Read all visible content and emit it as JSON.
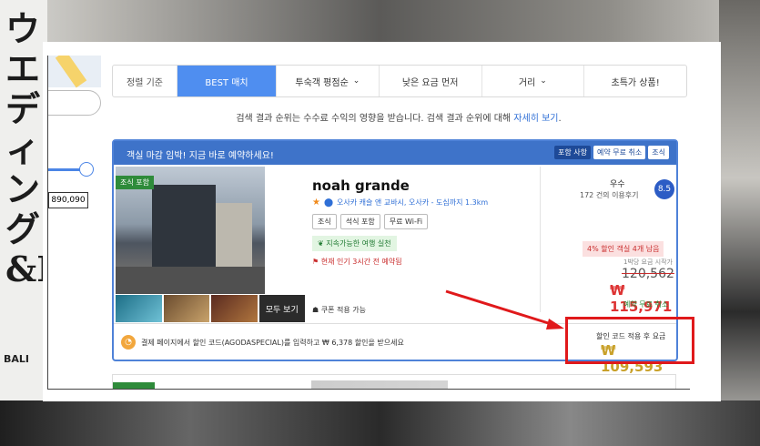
{
  "background": {
    "sign_text": "ウエディング&F",
    "sign_sub": "BALI"
  },
  "sidebar": {
    "price_value": "890,090"
  },
  "sort_bar": {
    "label": "정렬 기준",
    "options": [
      {
        "label": "BEST 매치",
        "active": true,
        "dropdown": false
      },
      {
        "label": "투숙객 평점순",
        "active": false,
        "dropdown": true
      },
      {
        "label": "낮은 요금 먼저",
        "active": false,
        "dropdown": false
      },
      {
        "label": "거리",
        "active": false,
        "dropdown": true
      },
      {
        "label": "초특가 상품!",
        "active": false,
        "dropdown": false
      }
    ]
  },
  "notice": {
    "text": "검색 결과 순위는 수수료 수익의 영향을 받습니다. 검색 결과 순위에 대해",
    "link": "자세히 보기",
    "end": "."
  },
  "hotel": {
    "banner": "객실 마감 임박! 지금 바로 예약하세요!",
    "badges": [
      "포함 사항",
      "예약 무료 취소",
      "조식"
    ],
    "meal_tag": "조식 포함",
    "name": "noah grande",
    "location": "오사카 캐슬 앤 교바시, 오사카 - 도심까지 1.3km",
    "amenities": [
      "조식",
      "석식 포함",
      "무료 Wi-Fi"
    ],
    "eco": "지속가능한 여행 실천",
    "popular": "현재 인기 3시간 전 예약됨",
    "view_all": "모두 보기",
    "coupon": "쿠폰 적용 가능",
    "rating_label": "우수",
    "rating_count": "172 건의 이용후기",
    "rating_score": "8.5",
    "discount_badge": "4% 할인 객실 4개 남음",
    "price_start_note": "1박당 요금 시작가",
    "old_price": "120,562",
    "current_price": "₩ 115,971",
    "free_cancel": "예약 무료 취소",
    "promo_text": "결제 페이지에서 할인 코드(AGODASPECIAL)를 입력하고 ₩ 6,378 할인을 받으세요",
    "after_code_label": "할인 코드 적용 후 요금",
    "after_code_price": "₩ 109,593"
  },
  "colors": {
    "accent": "#4f8ef0",
    "card_border": "#4f82d8",
    "highlight": "#e0191b",
    "gold": "#c9a12a"
  }
}
